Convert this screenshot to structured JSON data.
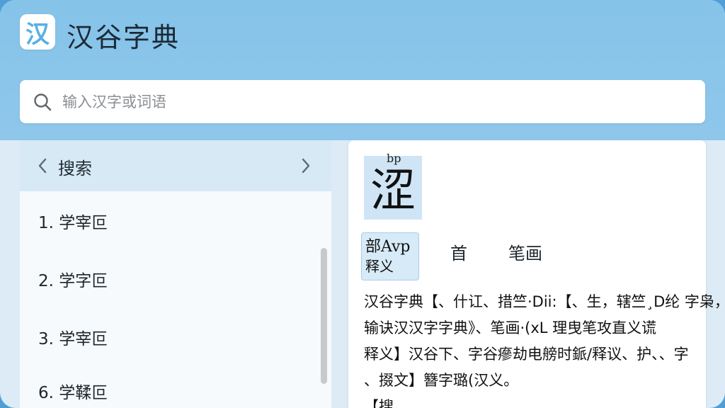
{
  "app": {
    "logo_char": "汉",
    "title": "汉谷字典"
  },
  "search": {
    "placeholder": "输入汉字或词语"
  },
  "left_panel": {
    "title": "搜索",
    "results": [
      "1. 学宰叵",
      "2. 学字叵",
      "3. 学宰叵",
      "6. 学鞣叵"
    ]
  },
  "detail": {
    "pinyin": "bp",
    "character": "涩",
    "radical_line1": "部Avp",
    "radical_line2": "释义",
    "tabs": [
      "首",
      "笔画"
    ],
    "definition_lines": [
      "汉谷字典【、什讧、措竺·Dii:【、生，辖竺¸D纶 字枭，",
      "输诀汉汉字字典》、笔画·(xL 理曳笔攻直义谎",
      "释义】汉谷下、字谷瘮劫电艕时䤨/释议、护、、字",
      "、掇文】簪字璐(汉义。",
      "【搜。"
    ]
  },
  "colors": {
    "header_bg": "#86c3e9",
    "accent": "#58b0e4",
    "panel_bg": "#d7e9f5"
  }
}
